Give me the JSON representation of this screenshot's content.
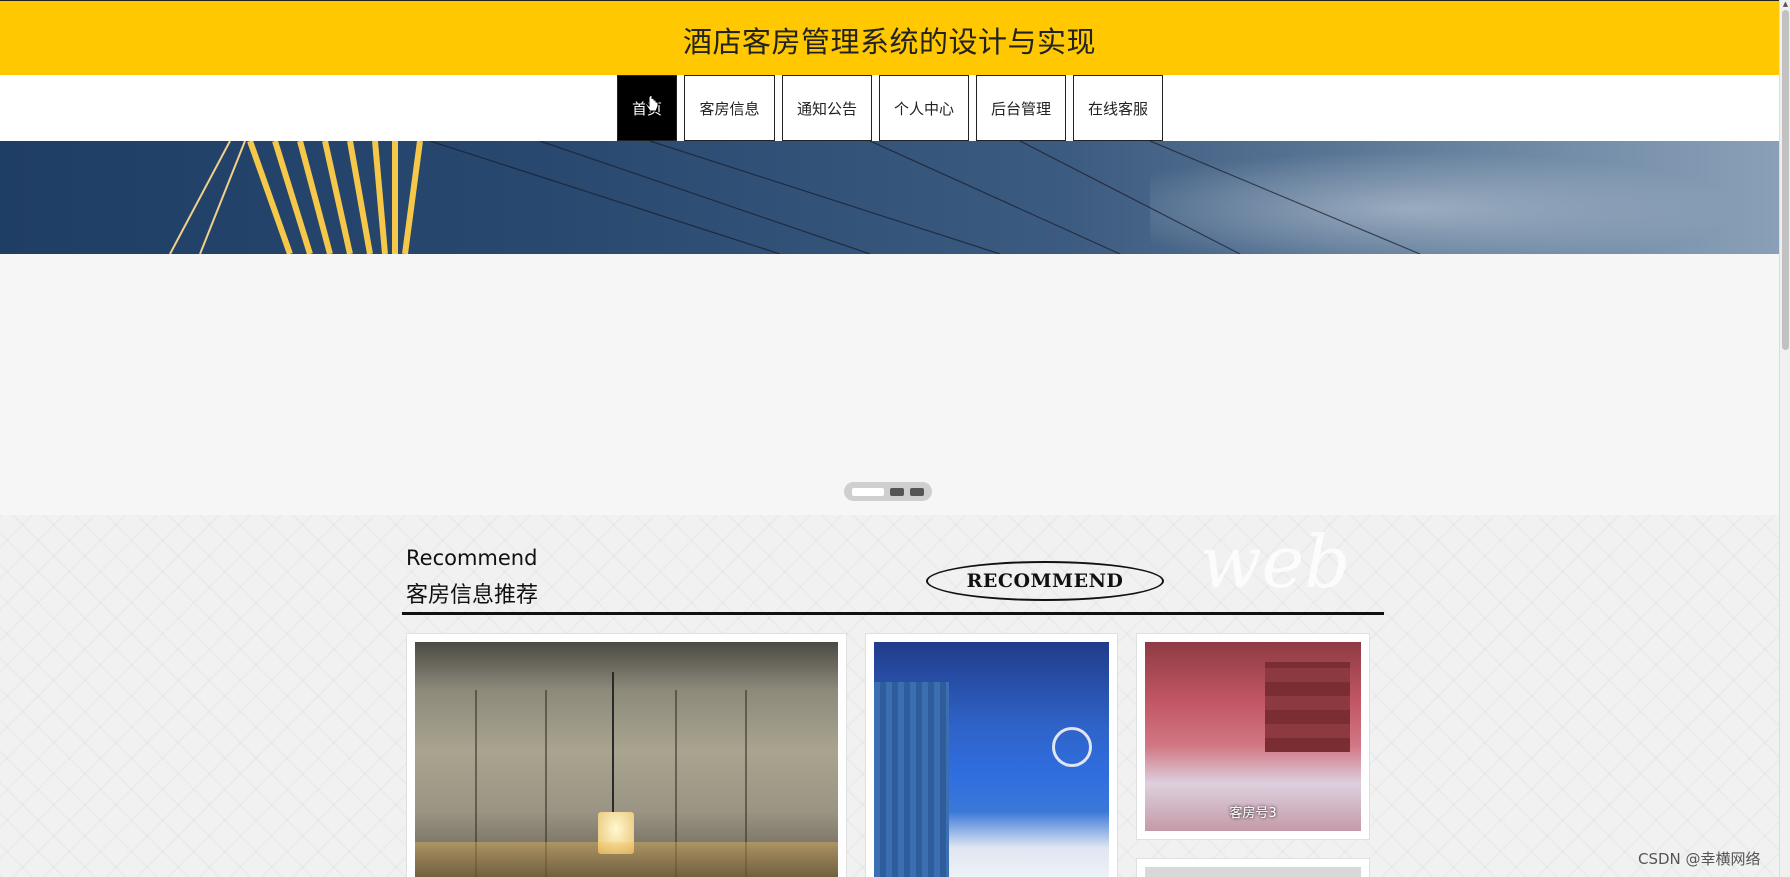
{
  "header": {
    "title": "酒店客房管理系统的设计与实现"
  },
  "nav": {
    "items": [
      {
        "label": "首页",
        "active": true
      },
      {
        "label": "客房信息",
        "active": false
      },
      {
        "label": "通知公告",
        "active": false
      },
      {
        "label": "个人中心",
        "active": false
      },
      {
        "label": "后台管理",
        "active": false
      },
      {
        "label": "在线客服",
        "active": false
      }
    ]
  },
  "slider": {
    "dots": 3,
    "active_dot": 1
  },
  "recommend": {
    "title_en": "Recommend",
    "title_cn": "客房信息推荐",
    "badge": "RECOMMEND",
    "decor_text": "web",
    "cards": [
      {
        "caption": ""
      },
      {
        "caption": ""
      },
      {
        "caption": "客房号3"
      },
      {
        "caption": ""
      }
    ]
  },
  "watermark": "CSDN @幸横网络",
  "colors": {
    "header_bg": "#ffc800",
    "nav_active_bg": "#000000"
  }
}
